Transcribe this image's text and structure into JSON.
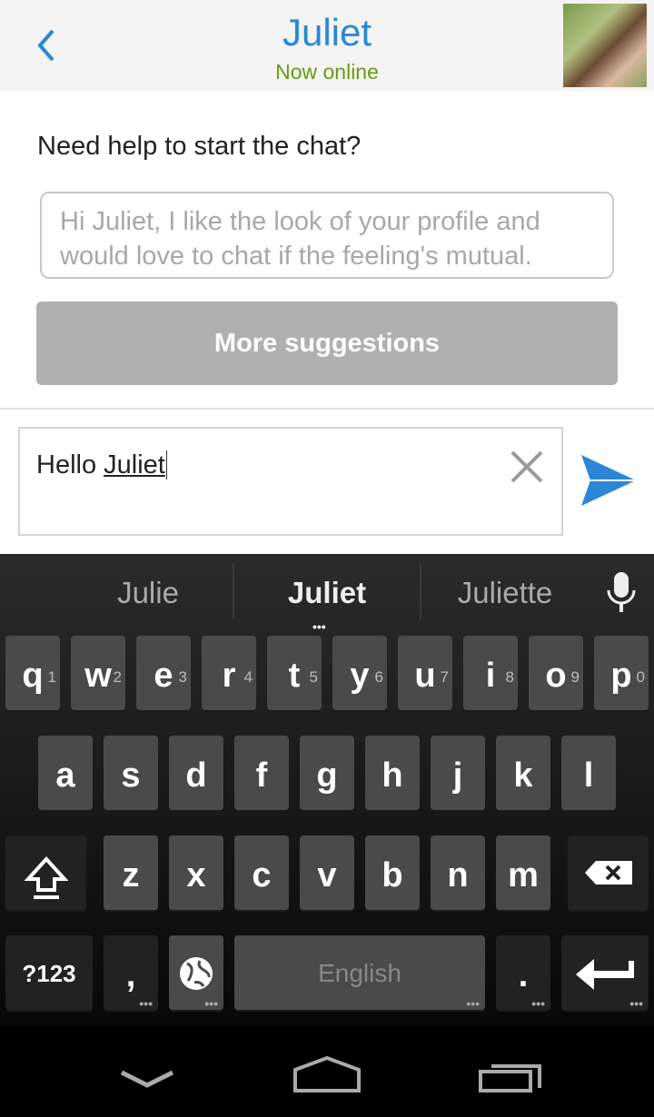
{
  "header": {
    "title": "Juliet",
    "status": "Now online"
  },
  "help": {
    "question": "Need help to start the chat?",
    "suggestion": "Hi Juliet, I like the look of your profile and would love to chat if the feeling's mutual.",
    "more_label": "More suggestions"
  },
  "composer": {
    "value_prefix": "Hello ",
    "value_word": "Juliet"
  },
  "keyboard": {
    "suggestions": [
      "Julie",
      "Juliet",
      "Juliette"
    ],
    "row1": [
      {
        "k": "q",
        "h": "1"
      },
      {
        "k": "w",
        "h": "2"
      },
      {
        "k": "e",
        "h": "3"
      },
      {
        "k": "r",
        "h": "4"
      },
      {
        "k": "t",
        "h": "5"
      },
      {
        "k": "y",
        "h": "6"
      },
      {
        "k": "u",
        "h": "7"
      },
      {
        "k": "i",
        "h": "8"
      },
      {
        "k": "o",
        "h": "9"
      },
      {
        "k": "p",
        "h": "0"
      }
    ],
    "row2": [
      "a",
      "s",
      "d",
      "f",
      "g",
      "h",
      "j",
      "k",
      "l"
    ],
    "row3": [
      "z",
      "x",
      "c",
      "v",
      "b",
      "n",
      "m"
    ],
    "symbols": "?123",
    "comma": ",",
    "space": "English",
    "period": "."
  },
  "colors": {
    "accent": "#2b87d6",
    "online": "#6a9a12"
  }
}
